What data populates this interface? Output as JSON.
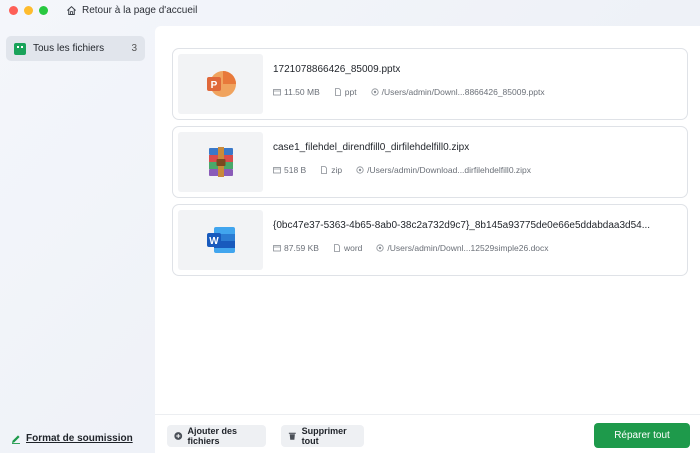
{
  "titlebar": {
    "home_label": "Retour à la page d'accueil"
  },
  "sidebar": {
    "items": [
      {
        "label": "Tous les fichiers",
        "count": "3"
      }
    ],
    "submit_label": "Format de soumission"
  },
  "files": [
    {
      "name": "1721078866426_85009.pptx",
      "size": "11.50 MB",
      "type": "ppt",
      "path": "/Users/admin/Downl...8866426_85009.pptx",
      "icon": "powerpoint-icon"
    },
    {
      "name": "case1_filehdel_direndfill0_dirfilehdelfill0.zipx",
      "size": "518 B",
      "type": "zip",
      "path": "/Users/admin/Download...dirfilehdelfill0.zipx",
      "icon": "archive-icon"
    },
    {
      "name": "{0bc47e37-5363-4b65-8ab0-38c2a732d9c7}_8b145a93775de0e66e5ddabdaa3d54...",
      "size": "87.59 KB",
      "type": "word",
      "path": "/Users/admin/Downl...12529simple26.docx",
      "icon": "word-icon"
    }
  ],
  "footer": {
    "add_label": "Ajouter des fichiers",
    "delete_label": "Supprimer tout",
    "repair_label": "Réparer tout"
  },
  "colors": {
    "accent": "#1e9a4b",
    "sidebar_active": "#e1e5ec"
  }
}
